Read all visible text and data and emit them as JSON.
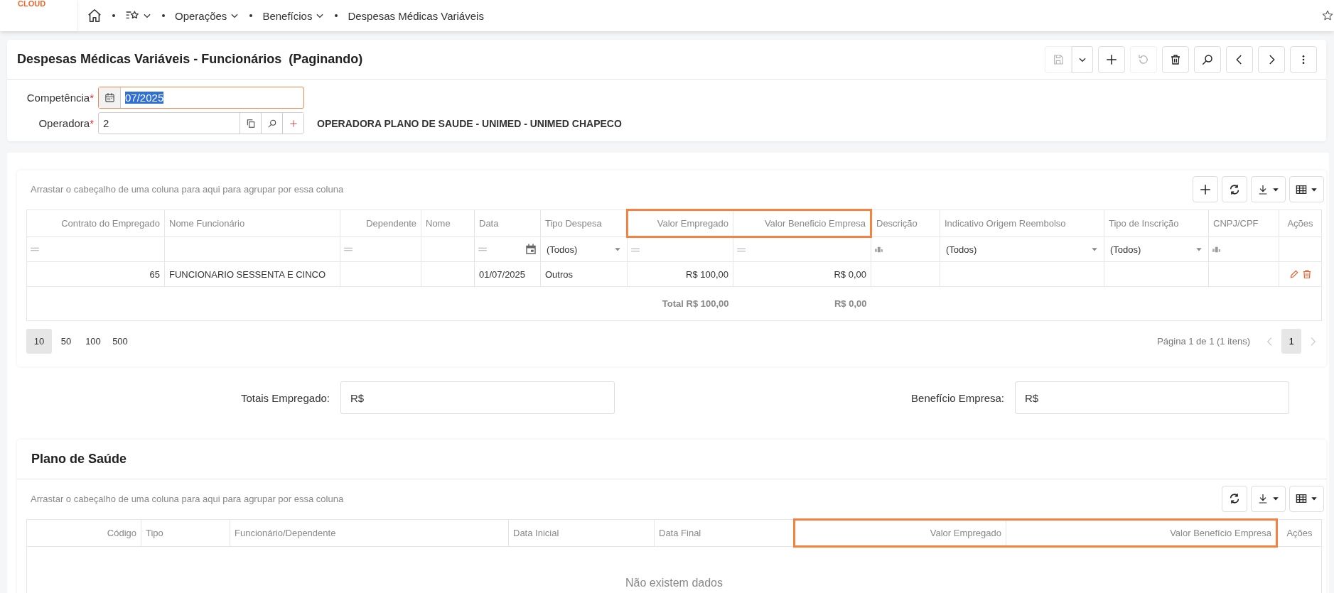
{
  "top_bar": {
    "logo": "CLOUD",
    "breadcrumbs": [
      {
        "kind": "home",
        "dropdown": false
      },
      {
        "kind": "favorites",
        "dropdown": true
      },
      {
        "kind": "text",
        "label": "Operações",
        "dropdown": true
      },
      {
        "kind": "text",
        "label": "Benefícios",
        "dropdown": true
      },
      {
        "kind": "text",
        "label": "Despesas Médicas Variáveis",
        "dropdown": false
      }
    ]
  },
  "form": {
    "title": "Despesas Médicas Variáveis - Funcionários",
    "subtitle": "(Paginando)",
    "toolbar": [
      {
        "kind": "save",
        "disabled": true
      },
      {
        "kind": "save-menu",
        "disabled": false
      },
      {
        "kind": "add",
        "disabled": false
      },
      {
        "kind": "undo",
        "disabled": true
      },
      {
        "kind": "delete",
        "disabled": false
      },
      {
        "kind": "search",
        "disabled": false
      },
      {
        "kind": "previous",
        "disabled": false
      },
      {
        "kind": "next",
        "disabled": false
      },
      {
        "kind": "more",
        "disabled": false
      }
    ],
    "fields": [
      {
        "kind": "date",
        "label": "Competência",
        "required_mark": "*",
        "value": "07/2025",
        "value_selected": true,
        "focused": true
      },
      {
        "kind": "lookup",
        "label": "Operadora",
        "required_mark": "*",
        "value": "2",
        "value_selected": false,
        "focused": false,
        "description": "OPERADORA PLANO DE SAUDE - UNIMED - UNIMED CHAPECO"
      }
    ]
  },
  "expenses_grid": {
    "group_hint": "Arrastar o cabeçalho de uma coluna para aqui para agrupar por essa coluna",
    "toolbar": [
      {
        "kind": "add",
        "disabled": false
      },
      {
        "kind": "refresh",
        "disabled": false
      },
      {
        "kind": "export",
        "disabled": false
      },
      {
        "kind": "columns",
        "disabled": false
      }
    ],
    "columns": [
      {
        "label": "Contrato do Empregado",
        "highlighted": false
      },
      {
        "label": "Nome Funcionário",
        "highlighted": false
      },
      {
        "label": "Dependente",
        "highlighted": false
      },
      {
        "label": "Nome",
        "highlighted": false
      },
      {
        "label": "Data",
        "highlighted": false
      },
      {
        "label": "Tipo Despesa",
        "highlighted": false
      },
      {
        "label": "Valor Empregado",
        "highlighted": true
      },
      {
        "label": "Valor Beneficio Empresa",
        "highlighted": true
      },
      {
        "label": "Descrição",
        "highlighted": false
      },
      {
        "label": "Indicativo Origem Reembolso",
        "highlighted": false
      },
      {
        "label": "Tipo de Inscrição",
        "highlighted": false
      },
      {
        "label": "CNPJ/CPF",
        "highlighted": false
      },
      {
        "label": "Ações",
        "highlighted": false
      }
    ],
    "filters": [
      {
        "kind": "equals"
      },
      {
        "kind": "none"
      },
      {
        "kind": "equals"
      },
      {
        "kind": "none"
      },
      {
        "kind": "date"
      },
      {
        "kind": "select",
        "value": "(Todos)"
      },
      {
        "kind": "equals"
      },
      {
        "kind": "equals"
      },
      {
        "kind": "text"
      },
      {
        "kind": "select",
        "value": "(Todos)"
      },
      {
        "kind": "select",
        "value": "(Todos)"
      },
      {
        "kind": "text"
      },
      {
        "kind": "none"
      }
    ],
    "rows": [
      {
        "cells": [
          "65",
          "FUNCIONARIO SESSENTA E CINCO",
          "",
          "",
          "01/07/2025",
          "Outros",
          "R$ 100,00",
          "R$ 0,00",
          "",
          "",
          "",
          "",
          ""
        ],
        "actions": [
          {
            "kind": "edit"
          },
          {
            "kind": "delete"
          }
        ]
      }
    ],
    "totals": {
      "employee_total": "Total R$ 100,00",
      "company_benefit_total": "R$ 0,00"
    },
    "pager": {
      "sizes": [
        {
          "label": "10",
          "selected": true
        },
        {
          "label": "50",
          "selected": false
        },
        {
          "label": "100",
          "selected": false
        },
        {
          "label": "500",
          "selected": false
        }
      ],
      "info": "Página 1 de 1 (1 itens)",
      "pages": [
        {
          "label": "1",
          "selected": true
        }
      ],
      "prev_disabled": true,
      "next_disabled": true
    }
  },
  "totals": [
    {
      "label": "Totais Empregado:",
      "value": "R$"
    },
    {
      "label": "Benefício Empresa:",
      "value": "R$"
    }
  ],
  "health_plan": {
    "title": "Plano de Saúde",
    "group_hint": "Arrastar o cabeçalho de uma coluna para aqui para agrupar por essa coluna",
    "toolbar": [
      {
        "kind": "refresh",
        "disabled": false
      },
      {
        "kind": "export",
        "disabled": false
      },
      {
        "kind": "columns",
        "disabled": false
      }
    ],
    "columns": [
      {
        "label": "Código",
        "highlighted": false
      },
      {
        "label": "Tipo",
        "highlighted": false
      },
      {
        "label": "Funcionário/Dependente",
        "highlighted": false
      },
      {
        "label": "Data Inicial",
        "highlighted": false
      },
      {
        "label": "Data Final",
        "highlighted": false
      },
      {
        "label": "Valor Empregado",
        "highlighted": true
      },
      {
        "label": "Valor Benefício Empresa",
        "highlighted": true
      },
      {
        "label": "Ações",
        "highlighted": false
      }
    ],
    "empty_text": "Não existem dados"
  }
}
